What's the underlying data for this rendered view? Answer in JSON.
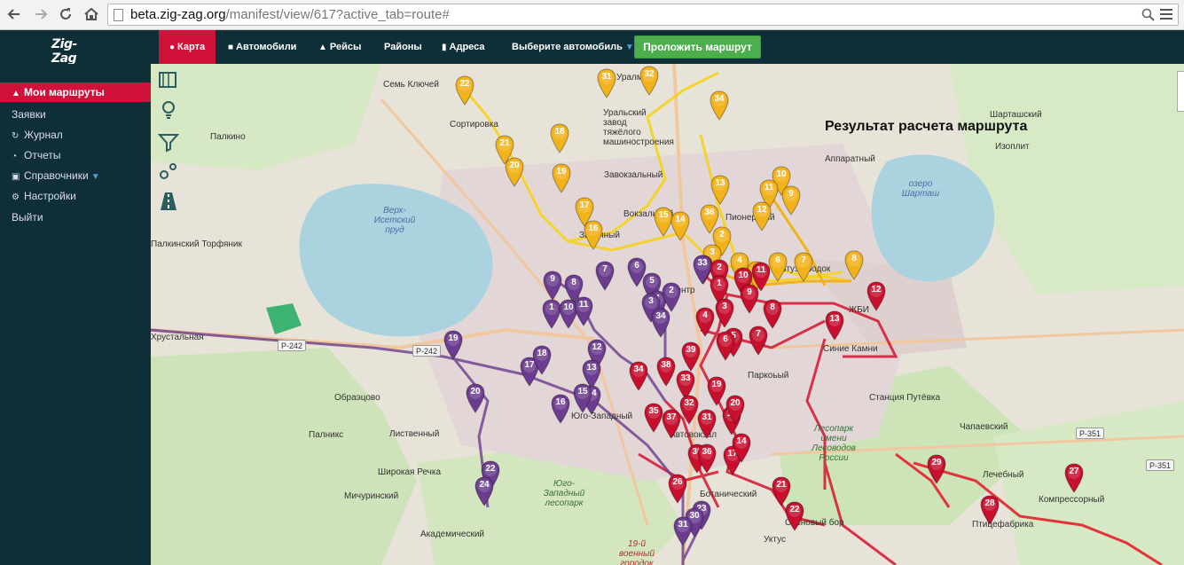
{
  "browser": {
    "url_host": "beta.zig-zag.org",
    "url_path": "/manifest/view/617?active_tab=route#"
  },
  "app": {
    "logo": "Zig-Zag",
    "nav": [
      {
        "label": "Карта",
        "icon": "map-marker-icon",
        "active": true
      },
      {
        "label": "Автомобили",
        "icon": "car-icon",
        "active": false
      },
      {
        "label": "Рейсы",
        "icon": "road-icon",
        "active": false
      },
      {
        "label": "Районы",
        "icon": "",
        "active": false
      },
      {
        "label": "Адреса",
        "icon": "document-icon",
        "active": false
      },
      {
        "label": "Выберите автомобиль",
        "icon": "",
        "active": false
      }
    ],
    "route_button": "Проложить маршрут"
  },
  "sidebar": {
    "items": [
      {
        "label": "Мои маршруты",
        "icon": "road-icon",
        "active": true
      },
      {
        "label": "Заявки",
        "icon": "",
        "active": false
      },
      {
        "label": "Журнал",
        "icon": "history-icon",
        "active": false
      },
      {
        "label": "Отчеты",
        "icon": "pie-chart-icon",
        "active": false
      },
      {
        "label": "Справочники",
        "icon": "book-icon",
        "active": false
      },
      {
        "label": "Настройки",
        "icon": "gear-icon",
        "active": false
      },
      {
        "label": "Выйти",
        "icon": "",
        "active": false
      }
    ]
  },
  "map": {
    "title": "Результат расчета маршрута",
    "colors": {
      "yellow": "#f2b21b",
      "red": "#c8102e",
      "purple": "#6b3c8f",
      "water": "#aad3df",
      "forest": "#cde6b8"
    },
    "labels": [
      "Семь Ключей",
      "Сортировка",
      "Палкино",
      "Уральский завод тяжёлого машиностроения",
      "Завокзальный",
      "Вокзальный",
      "Пионерский",
      "Шарташский",
      "Изоплит",
      "Аппаратный",
      "озеро Шарташ",
      "Верх-Исетский пруд",
      "Палкинский Торфяник",
      "Хрустальная",
      "Втузгородок",
      "ЖБИ",
      "Синие Камни",
      "Станция Путёвка",
      "Чапаевский",
      "Паркоьый",
      "Юго-Западный",
      "Автовокзал",
      "Обраэцово",
      "Лиственный",
      "Палникс",
      "Широкая Речка",
      "Мичуринский",
      "Академический",
      "Юго-Западный лесопарк",
      "Ботанический",
      "Лесопарк имени Лесоводов России",
      "Лечебный",
      "Компрессорный",
      "Птицефабрика",
      "Сосновый бор",
      "Уктус",
      "19-й военный городок",
      "Уралмаш",
      "Заречный",
      "Центр"
    ],
    "roads": [
      "Р-242",
      "Р-242",
      "Р-351",
      "Р-351"
    ],
    "markers": {
      "yellow": [
        "22",
        "31",
        "32",
        "34",
        "18",
        "21",
        "20",
        "19",
        "17",
        "16",
        "15",
        "14",
        "36",
        "13",
        "10",
        "11",
        "12",
        "9",
        "2",
        "3",
        "4",
        "5",
        "6",
        "7",
        "8"
      ],
      "red": [
        "1",
        "2",
        "1",
        "10",
        "11",
        "9",
        "3",
        "8",
        "4",
        "5",
        "6",
        "7",
        "12",
        "13",
        "39",
        "38",
        "34",
        "33",
        "19",
        "32",
        "35",
        "37",
        "31",
        "18",
        "20",
        "30",
        "36",
        "26",
        "17",
        "14",
        "21",
        "22",
        "29",
        "28",
        "27"
      ],
      "purple": [
        "9",
        "8",
        "7",
        "6",
        "5",
        "4",
        "2",
        "3",
        "34",
        "33",
        "1",
        "10",
        "11",
        "12",
        "13",
        "14",
        "15",
        "16",
        "17",
        "18",
        "19",
        "20",
        "22",
        "24",
        "23",
        "30",
        "31",
        "32"
      ]
    }
  }
}
